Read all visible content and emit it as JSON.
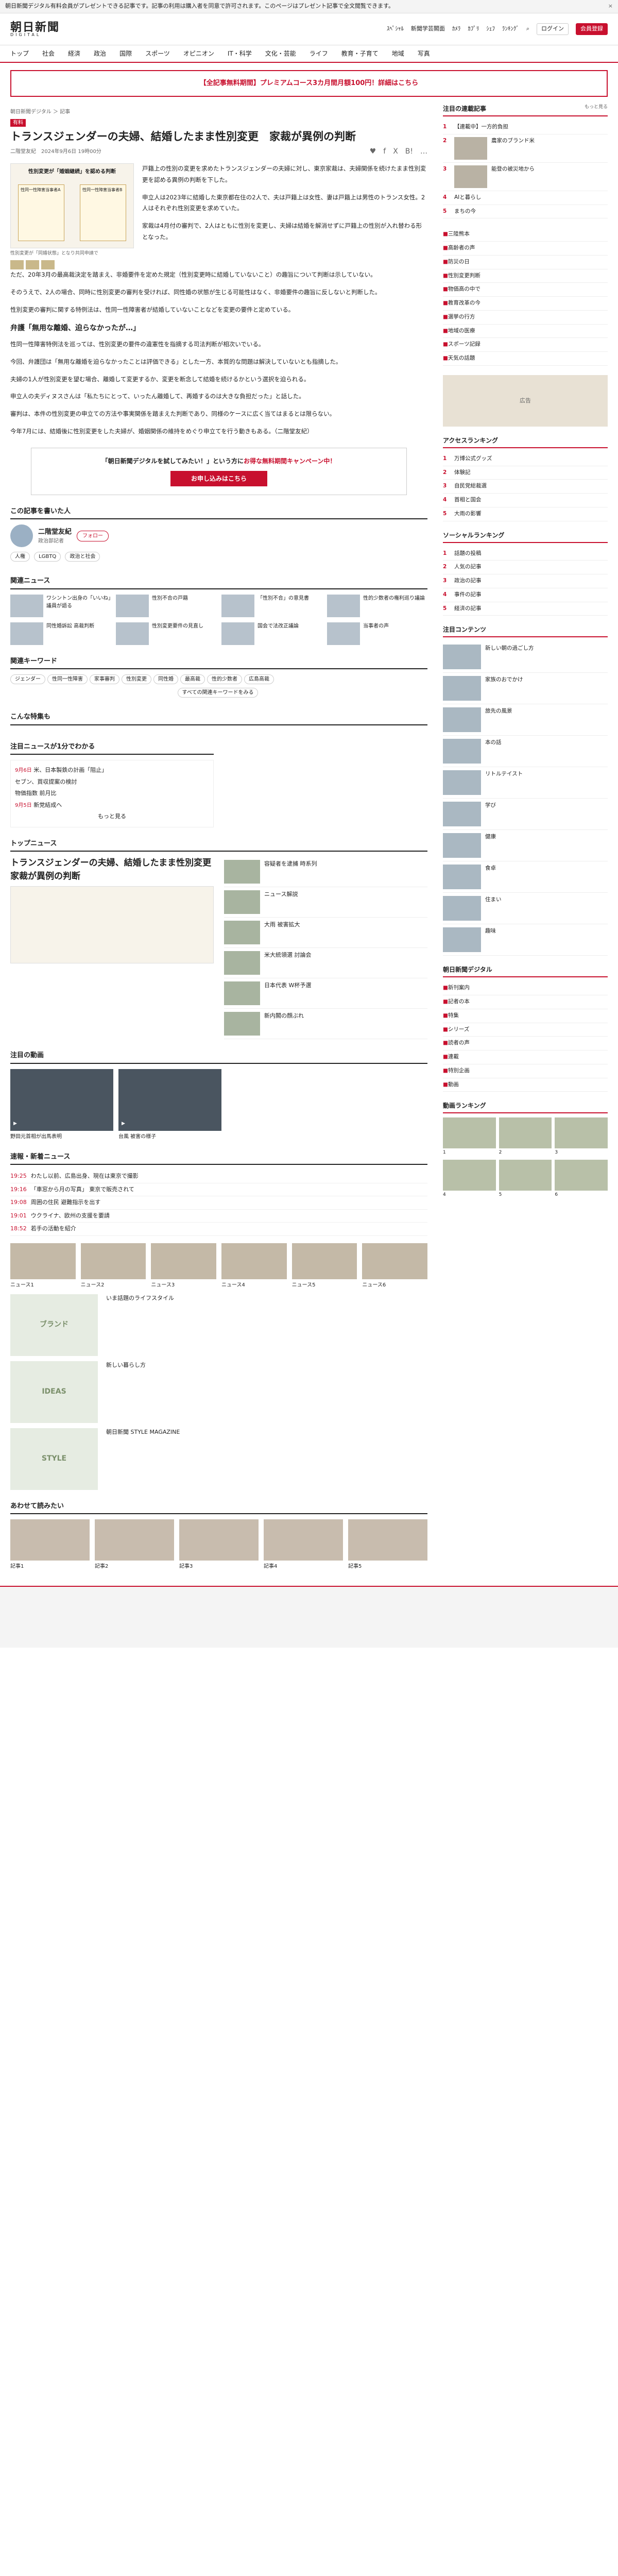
{
  "topbar": {
    "text": "朝日新聞デジタル有料会員がプレゼントできる記事です。記事の利用は購入者を同意で許可されます。このページはプレゼント記事で全文閲覧できます。",
    "close": "×"
  },
  "header": {
    "logo": "朝日新聞",
    "logo_sub": "DIGITAL",
    "links": [
      "ｽﾍﾟｼｬﾙ",
      "新聞学芸閣面",
      "ｶﾒﾗ",
      "ｶﾌﾟﾘ",
      "ｼｪﾌ",
      "ﾗﾝｷﾝｸﾞ"
    ],
    "login": "ログイン",
    "register": "会員登録"
  },
  "gnav": [
    "トップ",
    "社会",
    "経済",
    "政治",
    "国際",
    "スポーツ",
    "オピニオン",
    "IT・科学",
    "文化・芸能",
    "ライフ",
    "教育・子育て",
    "地域",
    "写真"
  ],
  "promo": "【全記事無料期間】プレミアムコース3カ月間月額100円！詳細はこちら",
  "article": {
    "crumb": "朝日新聞デジタル ＞ 記事",
    "tag": "有料",
    "title": "トランスジェンダーの夫婦、結婚したまま性別変更　家裁が異例の判断",
    "meta": "二階堂友紀　2024年9月6日 19時00分",
    "share": [
      "♥",
      "f",
      "X",
      "B!",
      "…"
    ],
    "fig_title": "性別変更が「婚姻継続」を認める判断",
    "fig_left": "性同一性障害当事者A",
    "fig_right": "性同一性障害当事者B",
    "fig_caption": "性別変更が「同婚状態」となり共同申請で",
    "paras": [
      "戸籍上の性別の変更を求めたトランスジェンダーの夫婦に対し、東京家裁は、夫婦関係を続けたまま性別変更を認める異例の判断を下した。",
      "申立人は2023年に結婚した東京都在住の2人で、夫は戸籍上は女性、妻は戸籍上は男性のトランス女性。2人はそれぞれ性別変更を求めていた。",
      "家裁は4月付の審判で、2人はともに性別を変更し、夫婦は結婚を解消せずに戸籍上の性別が入れ替わる形となった。",
      "ただ、20年3月の最高裁決定を踏まえ、非婚要件を定めた規定（性別変更時に結婚していないこと）の趣旨について判断は示していない。",
      "そのうえで、2人の場合、同時に性別変更の審判を受ければ、同性婚の状態が生じる可能性はなく、非婚要件の趣旨に反しないと判断した。",
      "性別変更の審判に関する特例法は、性同一性障害者が結婚していないことなどを変更の要件と定めている。"
    ],
    "sub": "弁護「無用な離婚、迫らなかったが…」",
    "paras2": [
      "性同一性障害特例法を巡っては、性別変更の要件の違憲性を指摘する司法判断が相次いでいる。",
      "今回、弁護団は「無用な離婚を迫らなかったことは評価できる」とした一方、本質的な問題は解決していないとも指摘した。",
      "夫婦の1人が性別変更を望む場合、離婚して変更するか、変更を断念して結婚を続けるかという選択を迫られる。",
      "申立人の夫ディヌスさんは「私たちにとって、いったん離婚して、再婚するのは大きな負担だった」と話した。",
      "審判は、本件の性別変更の申立ての方法や事実関係を踏まえた判断であり、同様のケースに広く当てはまるとは限らない。",
      "今年7月には、結婚後に性別変更をした夫婦が、婚姻関係の維持をめぐり申立てを行う動きもある。（二階堂友紀）"
    ],
    "cta_text": "「朝日新聞デジタルを試してみたい！」という方に",
    "cta_red": "お得な無料期間キャンペーン中！",
    "cta_button": "お申し込みはこちら"
  },
  "author": {
    "heading": "この記事を書いた人",
    "name": "二階堂友紀",
    "role": "政治部記者",
    "follow": "フォロー",
    "tags": [
      "人権",
      "LGBTQ",
      "政治と社会"
    ]
  },
  "related": {
    "heading": "関連ニュース",
    "items": [
      "ワシントン出身の「いいね」議員が語る",
      "性別不合の戸籍",
      "「性別不合」の意見書",
      "性的少数者の権利巡り議論",
      "同性婚訴訟 高裁判断",
      "性別変更要件の見直し",
      "国会で法改正議論",
      "当事者の声"
    ]
  },
  "keywords": {
    "heading": "関連キーワード",
    "items": [
      "ジェンダー",
      "性同一性障害",
      "家事審判",
      "性別変更",
      "同性婚",
      "最高裁",
      "性的少数者",
      "広島高裁"
    ],
    "more": "すべての関連キーワードをみる"
  },
  "special": {
    "heading": "こんな特集も"
  },
  "pickup": {
    "heading": "注目ニュースが1分でわかる",
    "items": [
      [
        "9月6日",
        "米、日本製鉄の計画「阻止」"
      ],
      [
        "",
        "セブン、買収提案の検討"
      ],
      [
        "",
        "物価指数 前月比"
      ],
      [
        "9月5日",
        "新党結成へ"
      ]
    ],
    "more": "もっと見る"
  },
  "top": {
    "heading": "トップニュース",
    "lead": "トランスジェンダーの夫婦、結婚したまま性別変更　家裁が異例の判断",
    "right": [
      "容疑者を逮捕 時系列",
      "ニュース解説",
      "大雨 被害拡大",
      "米大統領選 討論会",
      "日本代表 W杯予選",
      "新内閣の顔ぶれ"
    ]
  },
  "featured": {
    "heading": "注目の動画",
    "videos": [
      "野田元首相が出馬表明",
      "台風 被害の様子"
    ]
  },
  "breaking": {
    "heading": "速報・新着ニュース",
    "items": [
      [
        "19:25",
        "わたし以前、広島出身、現在は東京で撮影"
      ],
      [
        "19:16",
        "「車窓から月の写真」 東京で販売されて"
      ],
      [
        "19:08",
        "周囲の住民 避難指示を出す"
      ],
      [
        "19:01",
        "ウクライナ、欧州の支援を要請"
      ],
      [
        "18:52",
        "若手の活動を紹介"
      ]
    ]
  },
  "cards": [
    "ニュース1",
    "ニュース2",
    "ニュース3",
    "ニュース4",
    "ニュース5",
    "ニュース6"
  ],
  "ads": [
    [
      "ブランド",
      "いま話題のライフスタイル"
    ],
    [
      "IDEAS",
      "新しい暮らし方"
    ],
    [
      "STYLE",
      "朝日新聞 STYLE MAGAZINE"
    ]
  ],
  "recommend": {
    "heading": "あわせて読みたい",
    "items": [
      "記事1",
      "記事2",
      "記事3",
      "記事4",
      "記事5"
    ]
  },
  "side": {
    "ranking_h": "注目の連載記事",
    "ranking_more": "もっと見る",
    "ranking": [
      "【連載中】一方的負担",
      "農家のブランド米",
      "能登の被災地から",
      "AIと暮らし",
      "まちの今"
    ],
    "list2": [
      "三陸熊本",
      "高齢者の声",
      "防災の日",
      "性別変更判断",
      "物価高の中で",
      "教育改革の今",
      "選挙の行方",
      "地域の医療",
      "スポーツ記録",
      "天気の話題"
    ],
    "banner": "広告",
    "acc_h": "アクセスランキング",
    "acc": [
      "万博公式グッズ",
      "体験記",
      "自民党総裁選",
      "首相と国会",
      "大雨の影響"
    ],
    "social_h": "ソーシャルランキング",
    "social": [
      "話題の投稿",
      "人気の記事",
      "政治の記事",
      "事件の記事",
      "経済の記事"
    ],
    "contents_h": "注目コンテンツ",
    "contents": [
      "新しい朝の過ごし方",
      "家族のおでかけ",
      "旅先の風景",
      "本の話",
      "リトルテイスト",
      "学び",
      "健康",
      "食卓",
      "住まい",
      "趣味"
    ],
    "plus_h": "朝日新聞デジタル",
    "plus": [
      "新刊案内",
      "記者の本",
      "特集",
      "シリーズ",
      "読者の声",
      "連載",
      "特別企画",
      "動画"
    ],
    "rk_h": "動画ランキング",
    "rk": [
      "1",
      "2",
      "3",
      "4",
      "5",
      "6"
    ]
  }
}
